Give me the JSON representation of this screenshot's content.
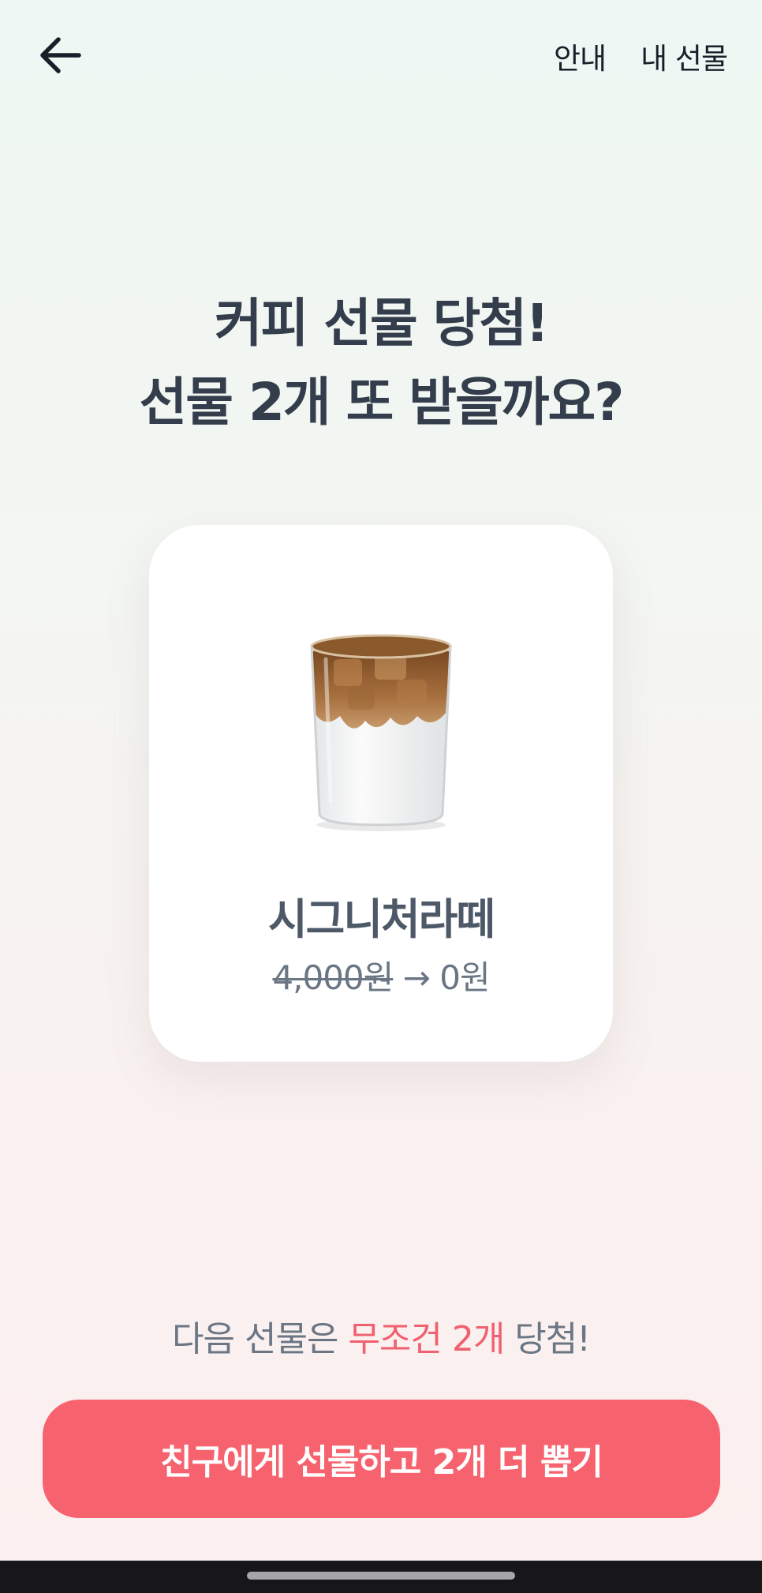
{
  "header": {
    "back_icon": "arrow-left-icon",
    "links": [
      "안내",
      "내 선물"
    ]
  },
  "headline": {
    "line1": "커피 선물 당첨!",
    "line2": "선물 2개 또 받을까요?"
  },
  "product": {
    "image": "iced-latte-cup",
    "name": "시그니처라떼",
    "original_price": "4,000원",
    "arrow": "→",
    "final_price": "0원"
  },
  "promo": {
    "prefix": "다음 선물은 ",
    "highlight": "무조건 2개",
    "suffix": " 당첨!"
  },
  "cta": {
    "label": "친구에게 선물하고 2개 더 뽑기"
  },
  "colors": {
    "accent": "#f6626e",
    "highlight": "#f0606e",
    "heading": "#333d4b"
  }
}
